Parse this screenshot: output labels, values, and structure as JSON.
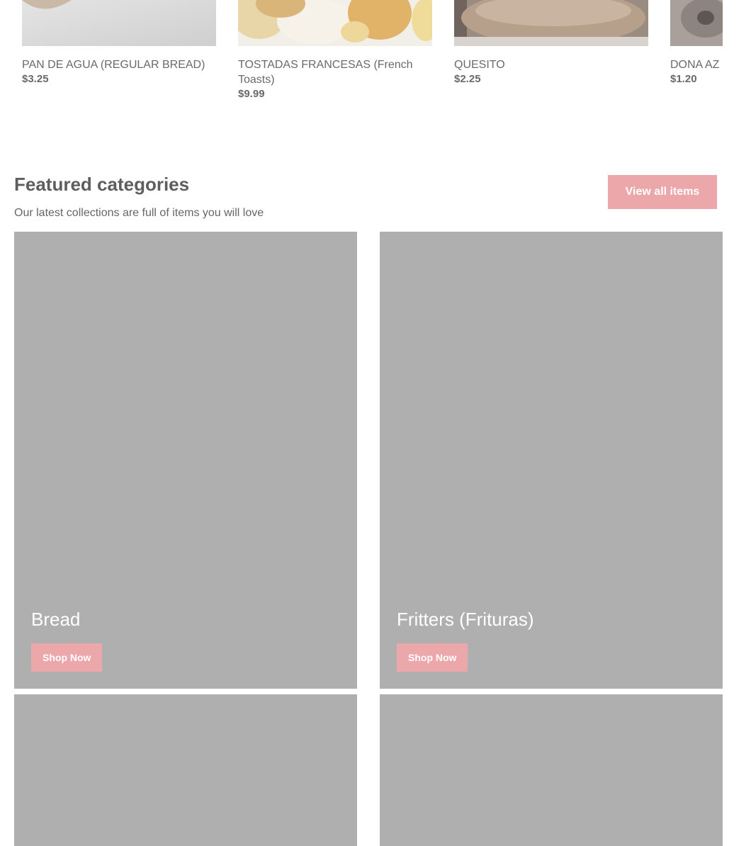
{
  "products": [
    {
      "name": "PAN DE AGUA (REGULAR BREAD)",
      "price": "$3.25",
      "image": "bread-photo"
    },
    {
      "name": "TOSTADAS FRANCESAS (French Toasts)",
      "price": "$9.99",
      "image": "french-toast-photo"
    },
    {
      "name": "QUESITO",
      "price": "$2.25",
      "image": "pastry-photo"
    },
    {
      "name": "DONA AZ",
      "price": "$1.20",
      "image": "donut-photo"
    }
  ],
  "featured": {
    "title": "Featured categories",
    "subtitle": "Our latest collections are full of items you will love",
    "view_all_label": "View all items",
    "categories": [
      {
        "name": "Bread",
        "button": "Shop Now"
      },
      {
        "name": "Fritters (Frituras)",
        "button": "Shop Now"
      },
      {
        "name": "",
        "button": ""
      },
      {
        "name": "",
        "button": ""
      }
    ]
  },
  "colors": {
    "accent_button": "#eba7a9",
    "tile_placeholder": "#afafaf",
    "text_primary": "#5e5e5e"
  }
}
